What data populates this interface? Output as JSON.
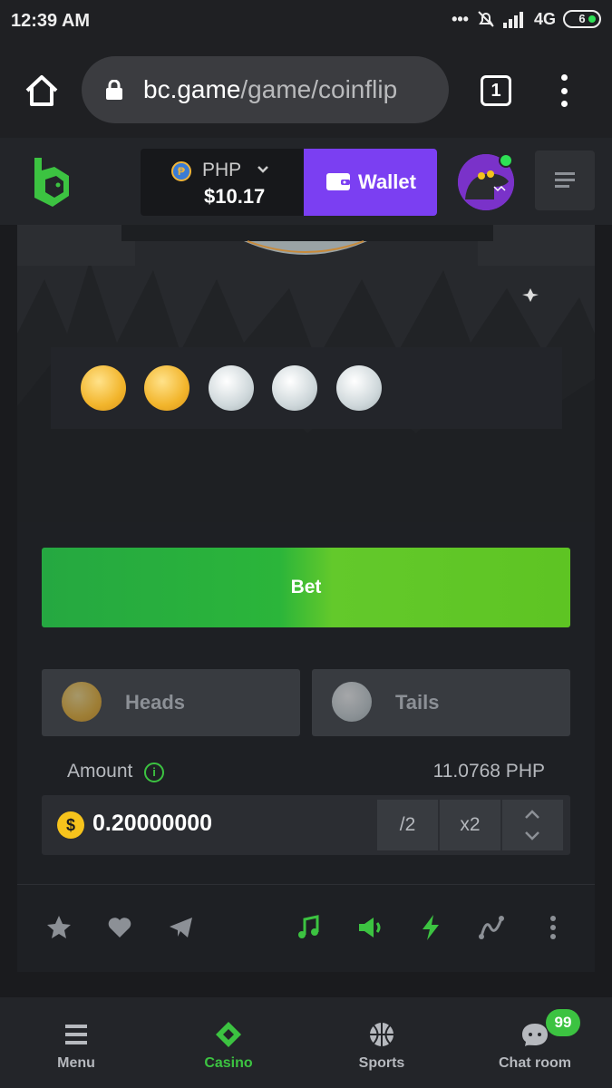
{
  "status_bar": {
    "time": "12:39 AM",
    "network": "4G",
    "battery": "6"
  },
  "browser": {
    "url_host": "bc.game",
    "url_path": "/game/coinflip",
    "tab_count": "1"
  },
  "header": {
    "currency": "PHP",
    "balance": "$10.17",
    "wallet_label": "Wallet"
  },
  "history": [
    "gold",
    "gold",
    "silver",
    "silver",
    "silver"
  ],
  "game": {
    "bet_label": "Bet",
    "heads_label": "Heads",
    "tails_label": "Tails",
    "amount_label": "Amount",
    "amount_max": "11.0768 PHP",
    "amount_value": "0.20000000",
    "currency_symbol": "$",
    "half_label": "/2",
    "double_label": "x2"
  },
  "bottom_nav": {
    "menu": "Menu",
    "casino": "Casino",
    "sports": "Sports",
    "chat": "Chat room",
    "chat_badge": "99"
  },
  "colors": {
    "accent_green": "#3cc341",
    "wallet_purple": "#7b3ff2"
  }
}
